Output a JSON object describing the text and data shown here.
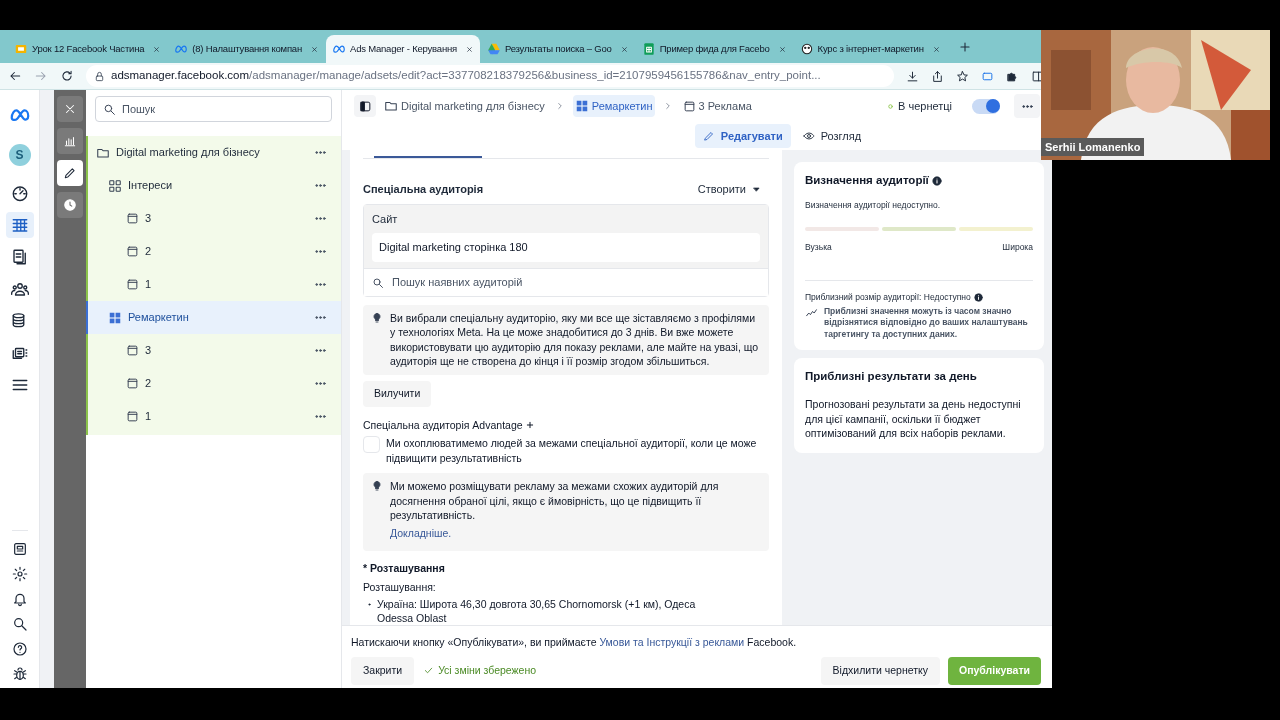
{
  "browser": {
    "tabs": [
      {
        "title": "Урок 12 Facebook Частина",
        "kind": "slides",
        "selected": false
      },
      {
        "title": "(8) Налаштування компан",
        "kind": "meta",
        "selected": false
      },
      {
        "title": "Ads Manager - Керування",
        "kind": "meta",
        "selected": true
      },
      {
        "title": "Результаты поиска – Goo",
        "kind": "drive",
        "selected": false
      },
      {
        "title": "Пример фида для Facebo",
        "kind": "sheets",
        "selected": false
      },
      {
        "title": "Курс з інтернет-маркетин",
        "kind": "generic",
        "selected": false
      }
    ],
    "url_host": "adsmanager.facebook.com",
    "url_path": "/adsmanager/manage/adsets/edit?act=337708218379256&business_id=2107959456155786&nav_entry_point..."
  },
  "nav_rail": {
    "avatar": "S",
    "items": [
      {
        "kind": "gauge",
        "selected": false
      },
      {
        "kind": "table",
        "selected": true
      },
      {
        "kind": "pages",
        "selected": false
      },
      {
        "kind": "people",
        "selected": false
      },
      {
        "kind": "coins",
        "selected": false
      },
      {
        "kind": "media",
        "selected": false
      },
      {
        "kind": "menu",
        "selected": false
      }
    ],
    "bottom_items": [
      {
        "kind": "news"
      },
      {
        "kind": "settings"
      },
      {
        "kind": "bell"
      },
      {
        "kind": "search"
      },
      {
        "kind": "help"
      },
      {
        "kind": "bug"
      }
    ]
  },
  "tool_strip": [
    {
      "kind": "close",
      "selected": false
    },
    {
      "kind": "chart",
      "selected": false
    },
    {
      "kind": "edit",
      "selected": true
    },
    {
      "kind": "history",
      "selected": false
    }
  ],
  "tree": {
    "search_placeholder": "Пошук",
    "items": [
      {
        "label": "Digital marketing для бізнесу",
        "kind": "campaign",
        "selected": false,
        "children": [
          {
            "label": "Інтереси",
            "kind": "adset",
            "selected": false,
            "children": [
              {
                "label": "3",
                "kind": "ad",
                "selected": false
              },
              {
                "label": "2",
                "kind": "ad",
                "selected": false
              },
              {
                "label": "1",
                "kind": "ad",
                "selected": false
              }
            ]
          },
          {
            "label": "Ремаркетин",
            "kind": "adset",
            "selected": true,
            "children": [
              {
                "label": "3",
                "kind": "ad",
                "selected": false
              },
              {
                "label": "2",
                "kind": "ad",
                "selected": false
              },
              {
                "label": "1",
                "kind": "ad",
                "selected": false
              }
            ]
          }
        ]
      }
    ]
  },
  "header": {
    "breadcrumbs": [
      {
        "label": "Digital marketing для бізнесу",
        "kind": "campaign",
        "selected": false
      },
      {
        "label": "Ремаркетин",
        "kind": "adset",
        "selected": true
      },
      {
        "label": "3 Реклама",
        "kind": "ad",
        "selected": false
      }
    ],
    "status": "В чернетці",
    "toggle_on": true,
    "modes": [
      {
        "label": "Редагувати",
        "kind": "edit",
        "selected": true
      },
      {
        "label": "Розгляд",
        "kind": "view",
        "selected": false
      }
    ]
  },
  "audience": {
    "title": "Спеціальна аудиторія",
    "create_button": "Створити",
    "category": "Сайт",
    "audience_name": "Digital marketing сторінка 180",
    "search_placeholder": "Пошук наявних аудиторій",
    "note": "Ви вибрали спеціальну аудиторію, яку ми все ще зіставляємо з профілями у технологіях Meta. На це може знадобитися до 3 днів. Ви вже можете використовувати цю аудиторію для показу реклами, але майте на увазі, що аудиторія ще не створена до кінця і її розмір згодом збільшиться.",
    "remove_button": "Вилучити",
    "advantage_title": "Спеціальна аудиторія Advantage",
    "advantage_checked": false,
    "advantage_text": "Ми охоплюватимемо людей за межами спеціальної аудиторії, коли це може підвищити результативність",
    "advantage_note": "Ми можемо розміщувати рекламу за межами схожих аудиторій для досягнення обраної цілі, якщо є ймовірність, що це підвищить її результативність.",
    "learn_more": "Докладніше."
  },
  "placement": {
    "title": "* Розташування",
    "label": "Розташування:",
    "items": [
      "Україна: Широта 46,30 довгота 30,65 Chornomorsk (+1 км), Одеса Odessa Oblast"
    ]
  },
  "definition": {
    "title": "Визначення аудиторії",
    "status": "Визначення аудиторії недоступно.",
    "narrow": "Вузька",
    "broad": "Широка",
    "size": "Приблизний розмір аудиторії: Недоступно",
    "size_note": "Приблизні значення можуть із часом значно відрізнятися відповідно до ваших налаштувань таргетингу та доступних даних."
  },
  "results": {
    "title": "Приблизні результати за день",
    "text": "Прогнозовані результати за день недоступні для цієї кампанії, оскільки її бюджет оптимізований для всіх наборів реклами."
  },
  "footer": {
    "terms_before": "Натискаючи кнопку «Опублікувати», ви приймаєте",
    "terms_link": "Умови та Інструкції з реклами",
    "terms_after": "Facebook.",
    "close": "Закрити",
    "saved": "Усі зміни збережено",
    "discard": "Відхилити чернетку",
    "publish": "Опублікувати"
  },
  "webcam": {
    "name": "Serhii Lomanenko"
  }
}
